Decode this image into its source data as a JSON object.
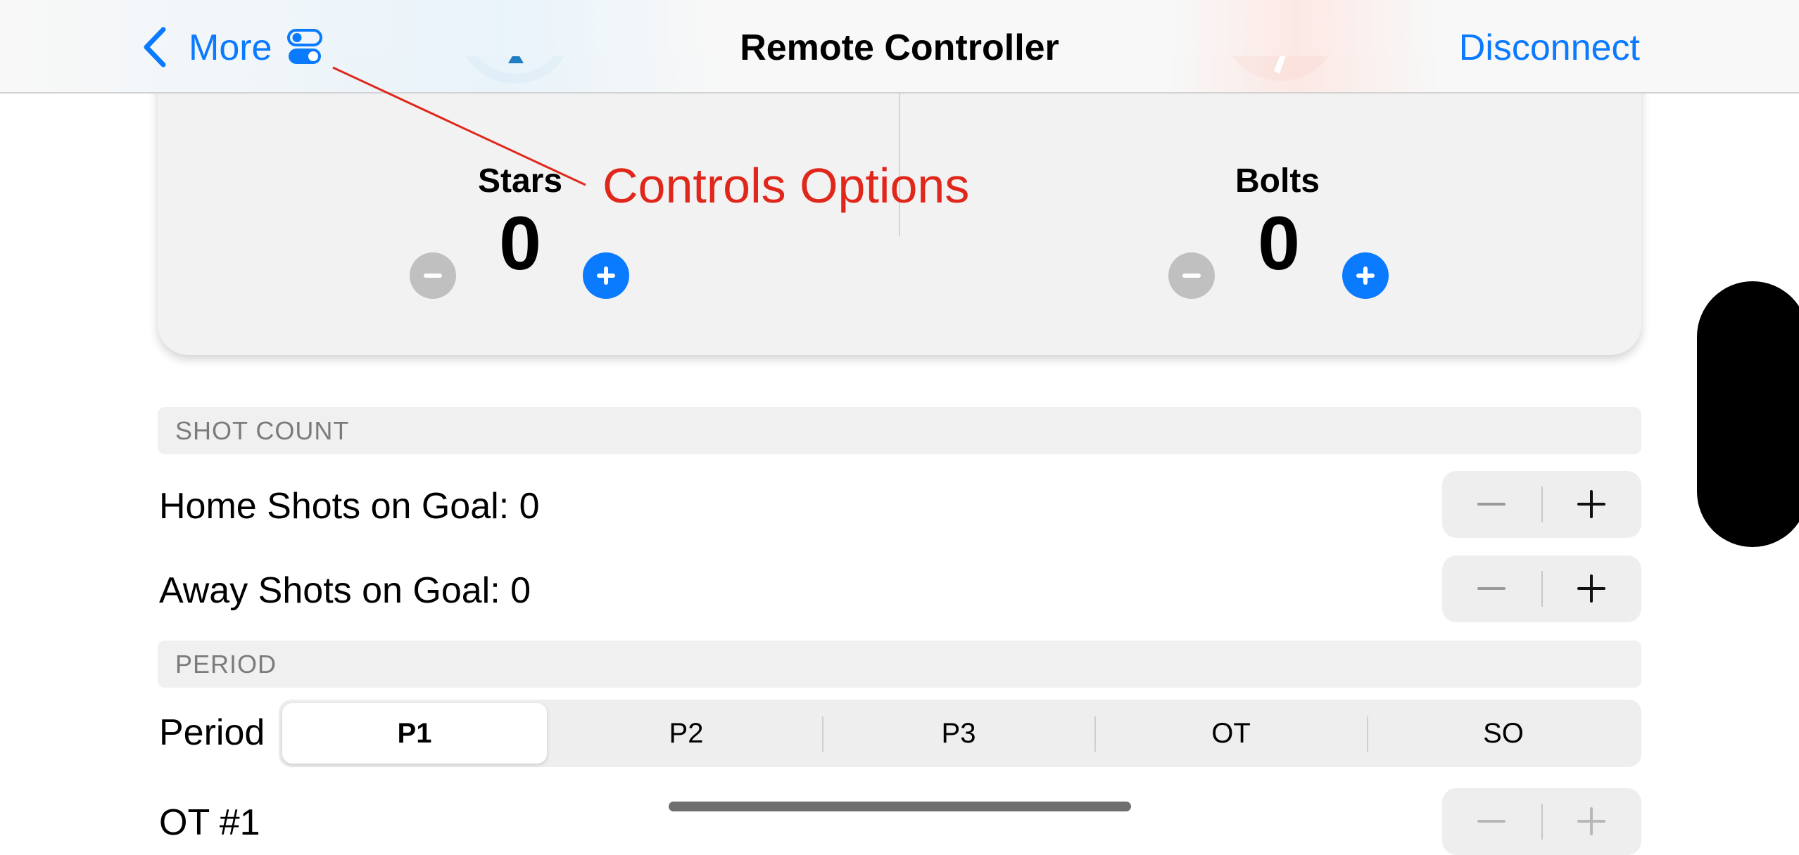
{
  "nav": {
    "back_label": "More",
    "title": "Remote Controller",
    "disconnect_label": "Disconnect",
    "accent_color": "#0a7aff"
  },
  "annotation": {
    "text": "Controls Options",
    "color": "#e0271b"
  },
  "scoreboard": {
    "home": {
      "name": "Stars",
      "score": "0",
      "logo_color": "#1f7dc2"
    },
    "away": {
      "name": "Bolts",
      "score": "0",
      "logo_color": "#e32c14"
    }
  },
  "shot_count": {
    "header": "SHOT COUNT",
    "home_label": "Home Shots on Goal: 0",
    "away_label": "Away Shots on Goal: 0"
  },
  "period": {
    "header": "PERIOD",
    "label": "Period",
    "options": [
      "P1",
      "P2",
      "P3",
      "OT",
      "SO"
    ],
    "selected": "P1"
  },
  "ot_row": {
    "label": "OT #1"
  },
  "icons": {
    "back": "chevron-left-icon",
    "options": "toggle-switches-icon",
    "minus": "minus-icon",
    "plus": "plus-icon"
  }
}
